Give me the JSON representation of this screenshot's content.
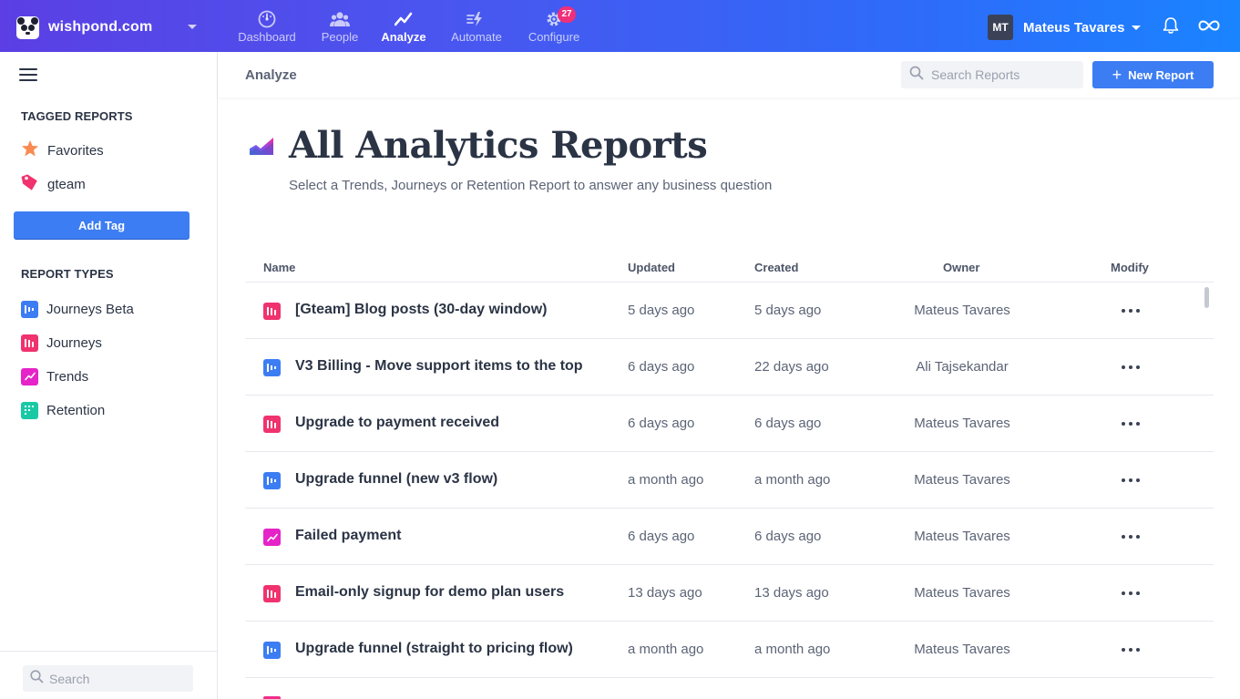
{
  "brand": {
    "name": "wishpond.com"
  },
  "nav": [
    {
      "label": "Dashboard",
      "icon": "gauge-icon",
      "active": false
    },
    {
      "label": "People",
      "icon": "people-icon",
      "active": false
    },
    {
      "label": "Analyze",
      "icon": "trend-line-icon",
      "active": true
    },
    {
      "label": "Automate",
      "icon": "lightning-icon",
      "active": false
    },
    {
      "label": "Configure",
      "icon": "gear-icon",
      "active": false,
      "badge": "27"
    }
  ],
  "user": {
    "initials": "MT",
    "name": "Mateus Tavares"
  },
  "sidebar": {
    "tagged_heading": "TAGGED REPORTS",
    "tags": [
      {
        "label": "Favorites",
        "icon": "star-icon"
      },
      {
        "label": "gteam",
        "icon": "tag-icon"
      }
    ],
    "add_tag_label": "Add Tag",
    "types_heading": "REPORT TYPES",
    "types": [
      {
        "label": "Journeys Beta",
        "icon": "journeys-beta-icon",
        "color": "#3d7df3"
      },
      {
        "label": "Journeys",
        "icon": "journeys-icon",
        "color": "#f0326e"
      },
      {
        "label": "Trends",
        "icon": "trends-icon",
        "color": "#e523c8"
      },
      {
        "label": "Retention",
        "icon": "retention-icon",
        "color": "#19c9a6"
      }
    ],
    "search_placeholder": "Search"
  },
  "subheader": {
    "breadcrumb": "Analyze",
    "search_placeholder": "Search Reports",
    "new_report_label": "New Report"
  },
  "main": {
    "title": "All Analytics Reports",
    "subtitle": "Select a Trends, Journeys or Retention Report to answer any business question"
  },
  "table": {
    "columns": {
      "name": "Name",
      "updated": "Updated",
      "created": "Created",
      "owner": "Owner",
      "modify": "Modify"
    },
    "rows": [
      {
        "type": "journeys",
        "name": "[Gteam] Blog posts (30-day window)",
        "updated": "5 days ago",
        "created": "5 days ago",
        "owner": "Mateus Tavares"
      },
      {
        "type": "journeys-beta",
        "name": "V3 Billing - Move support items to the top",
        "updated": "6 days ago",
        "created": "22 days ago",
        "owner": "Ali Tajsekandar"
      },
      {
        "type": "journeys",
        "name": "Upgrade to payment received",
        "updated": "6 days ago",
        "created": "6 days ago",
        "owner": "Mateus Tavares"
      },
      {
        "type": "journeys-beta",
        "name": "Upgrade funnel (new v3 flow)",
        "updated": "a month ago",
        "created": "a month ago",
        "owner": "Mateus Tavares"
      },
      {
        "type": "trends",
        "name": "Failed payment",
        "updated": "6 days ago",
        "created": "6 days ago",
        "owner": "Mateus Tavares"
      },
      {
        "type": "journeys",
        "name": "Email-only signup for demo plan users",
        "updated": "13 days ago",
        "created": "13 days ago",
        "owner": "Mateus Tavares"
      },
      {
        "type": "journeys-beta",
        "name": "Upgrade funnel (straight to pricing flow)",
        "updated": "a month ago",
        "created": "a month ago",
        "owner": "Mateus Tavares"
      }
    ]
  },
  "colors": {
    "accent": "#3d7df3",
    "journeys": "#f0326e",
    "journeys_beta": "#3d7df3",
    "trends": "#e523c8",
    "retention": "#19c9a6",
    "badge": "#ee2f7a"
  }
}
